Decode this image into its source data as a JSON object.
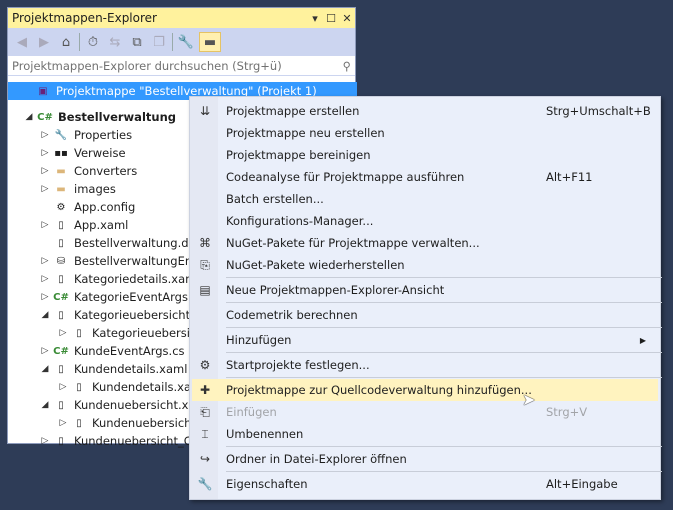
{
  "panel": {
    "title": "Projektmappen-Explorer",
    "controls": {
      "dropdown": "▾",
      "maximize": "☐",
      "close": "✕"
    },
    "toolbar": [
      {
        "name": "back-icon",
        "glyph": "◀"
      },
      {
        "name": "forward-icon",
        "glyph": "▶"
      },
      {
        "name": "home-icon",
        "glyph": "⌂"
      },
      {
        "name": "history-icon",
        "glyph": "⏱"
      },
      {
        "name": "sync-icon",
        "glyph": "⇆"
      },
      {
        "name": "collapse-all-icon",
        "glyph": "⧉"
      },
      {
        "name": "copy-icon",
        "glyph": "❐"
      },
      {
        "name": "properties-wrench-icon",
        "glyph": "🔧"
      },
      {
        "name": "preview-icon",
        "glyph": "▬"
      }
    ],
    "search_placeholder": "Projektmappen-Explorer durchsuchen (Strg+ü)",
    "search_icon": "⚲"
  },
  "tree": [
    {
      "label": "Projektmappe \"Bestellverwaltung\" (Projekt 1)",
      "depth": 0,
      "expander": "",
      "icon": "▣",
      "selected": true
    },
    {
      "label": "Bestellverwaltung",
      "depth": 0,
      "expander": "◢",
      "icon": "C#",
      "bold": true
    },
    {
      "label": "Properties",
      "depth": 1,
      "expander": "▷",
      "icon": "🔧"
    },
    {
      "label": "Verweise",
      "depth": 1,
      "expander": "▷",
      "icon": "▪▪"
    },
    {
      "label": "Converters",
      "depth": 1,
      "expander": "▷",
      "icon": "▬"
    },
    {
      "label": "images",
      "depth": 1,
      "expander": "▷",
      "icon": "▬"
    },
    {
      "label": "App.config",
      "depth": 1,
      "expander": "",
      "icon": "⚙"
    },
    {
      "label": "App.xaml",
      "depth": 1,
      "expander": "▷",
      "icon": "▯"
    },
    {
      "label": "Bestellverwaltung.db",
      "depth": 1,
      "expander": "",
      "icon": "▯"
    },
    {
      "label": "BestellverwaltungEnti",
      "depth": 1,
      "expander": "▷",
      "icon": "⛁"
    },
    {
      "label": "Kategoriedetails.xaml",
      "depth": 1,
      "expander": "▷",
      "icon": "▯"
    },
    {
      "label": "KategorieEventArgs.c",
      "depth": 1,
      "expander": "▷",
      "icon": "C#"
    },
    {
      "label": "Kategorieuebersicht.x",
      "depth": 1,
      "expander": "◢",
      "icon": "▯"
    },
    {
      "label": "Kategorieuebersic",
      "depth": 2,
      "expander": "▷",
      "icon": "▯"
    },
    {
      "label": "KundeEventArgs.cs",
      "depth": 1,
      "expander": "▷",
      "icon": "C#"
    },
    {
      "label": "Kundendetails.xaml",
      "depth": 1,
      "expander": "◢",
      "icon": "▯"
    },
    {
      "label": "Kundendetails.xan",
      "depth": 2,
      "expander": "▷",
      "icon": "▯"
    },
    {
      "label": "Kundenuebersicht.xar",
      "depth": 1,
      "expander": "◢",
      "icon": "▯"
    },
    {
      "label": "Kundenuebersicht",
      "depth": 2,
      "expander": "▷",
      "icon": "▯"
    },
    {
      "label": "Kundenuebersicht_Co",
      "depth": 1,
      "expander": "▷",
      "icon": "▯"
    }
  ],
  "menu": [
    {
      "label": "Projektmappe erstellen",
      "shortcut": "Strg+Umschalt+B",
      "icon": "build-icon",
      "glyph": "⇊"
    },
    {
      "label": "Projektmappe neu erstellen"
    },
    {
      "label": "Projektmappe bereinigen"
    },
    {
      "label": "Codeanalyse für Projektmappe ausführen",
      "shortcut": "Alt+F11"
    },
    {
      "label": "Batch erstellen..."
    },
    {
      "label": "Konfigurations-Manager..."
    },
    {
      "label": "NuGet-Pakete für Projektmappe verwalten...",
      "icon": "nuget-package-icon",
      "glyph": "⌘"
    },
    {
      "label": "NuGet-Pakete wiederherstellen",
      "icon": "restore-packages-icon",
      "glyph": "⎘"
    },
    {
      "label": "Neue Projektmappen-Explorer-Ansicht",
      "icon": "new-view-icon",
      "glyph": "▤"
    },
    {
      "label": "Codemetrik berechnen"
    },
    {
      "label": "Hinzufügen",
      "submenu": "▶"
    },
    {
      "label": "Startprojekte festlegen...",
      "icon": "gear-icon",
      "glyph": "⚙"
    },
    {
      "label": "Projektmappe zur Quellcodeverwaltung hinzufügen...",
      "icon": "source-control-add-icon",
      "glyph": "✚",
      "highlighted": true
    },
    {
      "label": "Einfügen",
      "shortcut": "Strg+V",
      "icon": "paste-icon",
      "glyph": "⎗",
      "disabled": true
    },
    {
      "label": "Umbenennen",
      "icon": "rename-icon",
      "glyph": "⌶"
    },
    {
      "label": "Ordner in Datei-Explorer öffnen",
      "icon": "open-folder-arrow-icon",
      "glyph": "↪"
    },
    {
      "label": "Eigenschaften",
      "shortcut": "Alt+Eingabe",
      "icon": "wrench-icon",
      "glyph": "🔧"
    }
  ],
  "colors": {
    "title": "#fff29d",
    "selection": "#3399ff",
    "highlight": "#fff3bf",
    "background": "#2e3c57"
  }
}
